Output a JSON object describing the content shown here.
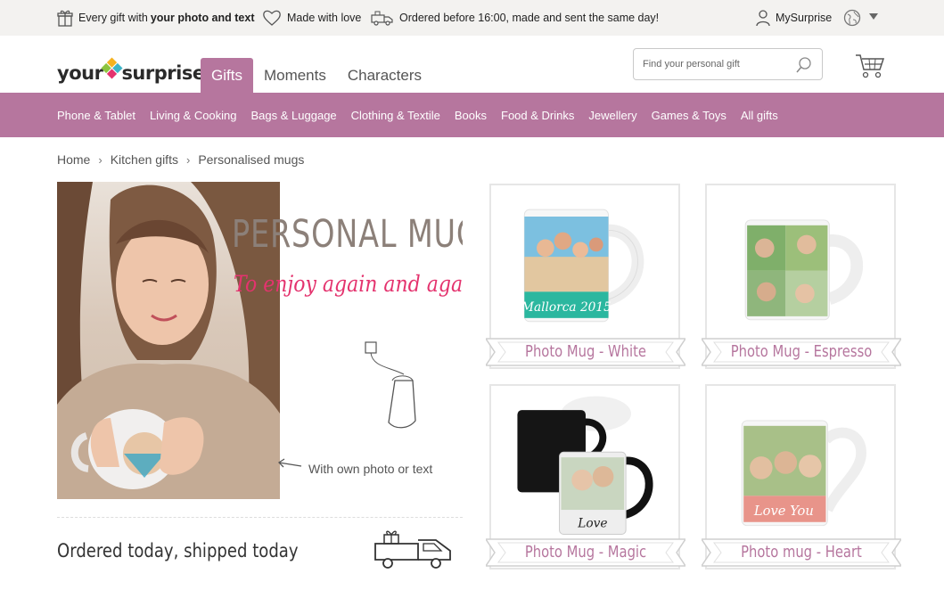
{
  "usp": {
    "gift_prefix": "Every gift with",
    "gift_bold": "your photo and text",
    "love": "Made with love",
    "ordered": "Ordered before 16:00, made and sent the same day!",
    "account": "MySurprise"
  },
  "header": {
    "logo_part1": "your",
    "logo_part2": "surprise",
    "tabs": [
      {
        "label": "Gifts"
      },
      {
        "label": "Moments"
      },
      {
        "label": "Characters"
      }
    ],
    "search_placeholder": "Find your personal gift"
  },
  "categories": [
    "Phone & Tablet",
    "Living & Cooking",
    "Bags & Luggage",
    "Clothing & Textile",
    "Books",
    "Food & Drinks",
    "Jewellery",
    "Games & Toys",
    "All gifts"
  ],
  "breadcrumb": [
    "Home",
    "Kitchen gifts",
    "Personalised mugs"
  ],
  "hero": {
    "title": "PERSONAL MUG",
    "subtitle": "To enjoy again and again",
    "note": "With own photo or text"
  },
  "shipped": "Ordered today, shipped today",
  "products": [
    {
      "name": "Photo Mug - White",
      "mug_text": "Mallorca 2015"
    },
    {
      "name": "Photo Mug - Espresso"
    },
    {
      "name": "Photo Mug - Magic",
      "mug_text": "Love"
    },
    {
      "name": "Photo mug - Heart",
      "mug_text": "Love You"
    }
  ],
  "colors": {
    "brand": "#b6769e",
    "accent_pink": "#e4336e",
    "topbar_bg": "#f3f2f0"
  }
}
